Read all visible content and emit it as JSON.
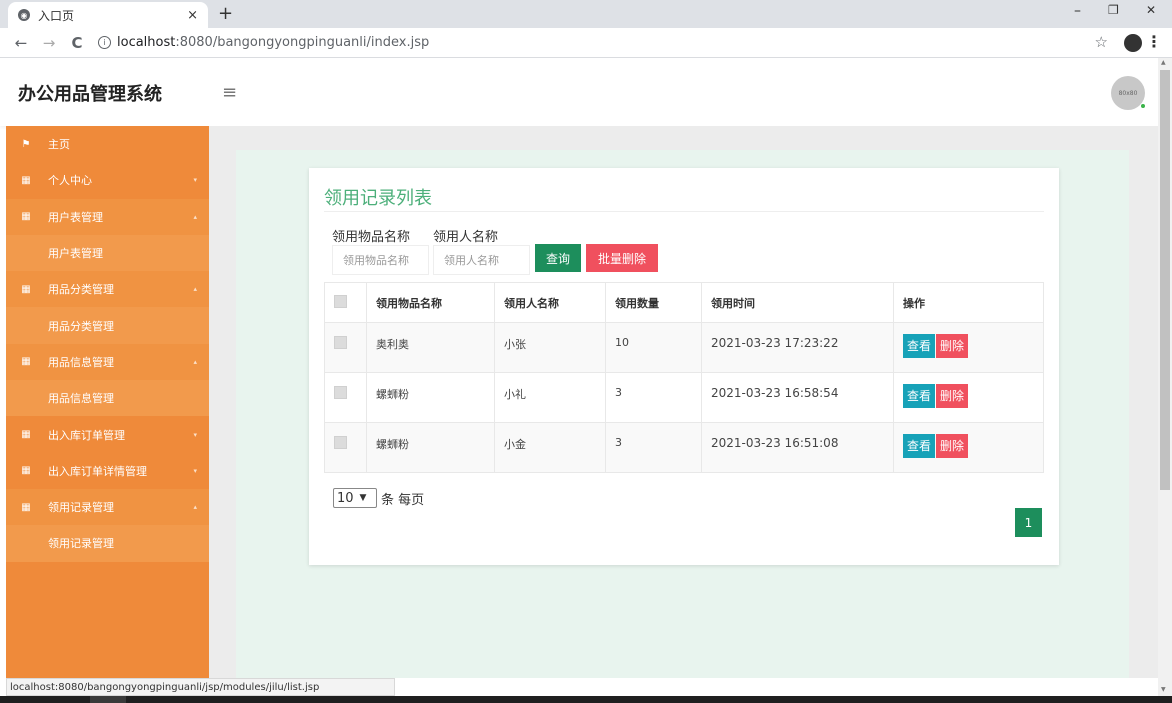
{
  "browser": {
    "tab_title": "入口页",
    "tab_close": "×",
    "new_tab": "+",
    "win_min": "–",
    "win_restore": "❐",
    "win_close": "✕",
    "back": "←",
    "forward": "→",
    "reload": "C",
    "url_host": "localhost",
    "url_rest": ":8080/bangongyongpinguanli/index.jsp",
    "bookmark": "☆",
    "menu": "⋮"
  },
  "header": {
    "brand": "办公用品管理系统",
    "hamburger": "≡",
    "avatar_text": "80x80"
  },
  "sidebar": {
    "items": [
      {
        "label": "主页",
        "icon": "flag-icon",
        "caret": ""
      },
      {
        "label": "个人中心",
        "icon": "grid-icon",
        "caret": "▾"
      },
      {
        "label": "用户表管理",
        "icon": "grid-icon",
        "caret": "▴"
      },
      {
        "label": "用户表管理"
      },
      {
        "label": "用品分类管理",
        "icon": "grid-icon",
        "caret": "▴"
      },
      {
        "label": "用品分类管理"
      },
      {
        "label": "用品信息管理",
        "icon": "grid-icon",
        "caret": "▴"
      },
      {
        "label": "用品信息管理"
      },
      {
        "label": "出入库订单管理",
        "icon": "grid-icon",
        "caret": "▾"
      },
      {
        "label": "出入库订单详情管理",
        "icon": "grid-icon",
        "caret": "▾"
      },
      {
        "label": "领用记录管理",
        "icon": "grid-icon",
        "caret": "▴"
      },
      {
        "label": "领用记录管理"
      }
    ]
  },
  "main": {
    "title": "领用记录列表",
    "filters": {
      "item_label": "领用物品名称",
      "item_placeholder": "领用物品名称",
      "person_label": "领用人名称",
      "person_placeholder": "领用人名称"
    },
    "search_button": "查询",
    "batch_delete_button": "批量删除",
    "table": {
      "columns": [
        "领用物品名称",
        "领用人名称",
        "领用数量",
        "领用时间",
        "操作"
      ],
      "rows": [
        {
          "item": "奥利奥",
          "person": "小张",
          "qty": "10",
          "time": "2021-03-23 17:23:22"
        },
        {
          "item": "螺蛳粉",
          "person": "小礼",
          "qty": "3",
          "time": "2021-03-23 16:58:54"
        },
        {
          "item": "螺蛳粉",
          "person": "小金",
          "qty": "3",
          "time": "2021-03-23 16:51:08"
        }
      ],
      "view_label": "查看",
      "delete_label": "删除"
    },
    "page_size": "10",
    "page_size_suffix": "条 每页",
    "current_page": "1"
  },
  "status_url": "localhost:8080/bangongyongpinguanli/jsp/modules/jilu/list.jsp"
}
